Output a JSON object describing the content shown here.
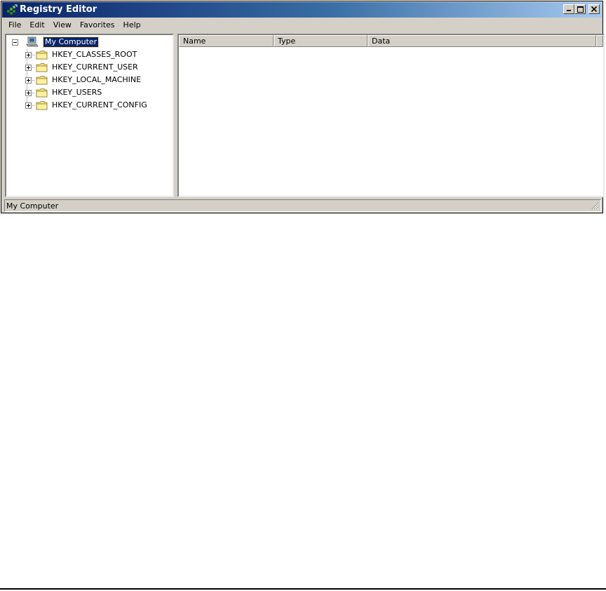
{
  "window": {
    "title": "Registry Editor"
  },
  "menu": [
    "File",
    "Edit",
    "View",
    "Favorites",
    "Help"
  ],
  "tree": {
    "root": "My Computer",
    "children": [
      "HKEY_CLASSES_ROOT",
      "HKEY_CURRENT_USER",
      "HKEY_LOCAL_MACHINE",
      "HKEY_USERS",
      "HKEY_CURRENT_CONFIG"
    ]
  },
  "list": {
    "columns": [
      "Name",
      "Type",
      "Data"
    ]
  },
  "status": {
    "text": "My Computer"
  },
  "colors": {
    "titlebar_start": "#0a246a",
    "titlebar_end": "#a6caf0",
    "face": "#d4d0c8",
    "selection": "#0a246a"
  },
  "icons": [
    "regedit-app-icon",
    "minimize-icon",
    "maximize-icon",
    "close-icon",
    "computer-icon",
    "folder-icon",
    "expand-icon",
    "collapse-icon",
    "resize-grip-icon"
  ]
}
